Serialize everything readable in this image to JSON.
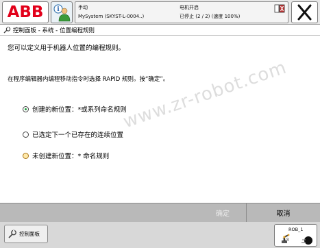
{
  "topbar": {
    "logo_text": "ABB",
    "status": {
      "mode": "手动",
      "system": "MySystem (SKYST-L-0004..)",
      "motor_state": "电机开启",
      "program_state": "已停止 (2 / 2) (速度 100%)"
    }
  },
  "breadcrumb": {
    "text": "控制面板 - 系统 - 位置编程规则"
  },
  "main": {
    "intro": "您可以定义用于机器人位置的编程规则。",
    "instruction": "在程序编辑器内编程移动指令时选择 RAPID 规则。按“确定”。",
    "options": [
      {
        "label": "创建的新位置：*或系列命名规则",
        "selected": true
      },
      {
        "label": "已选定下一个已存在的连续位置",
        "selected": false
      },
      {
        "label": "未创建新位置：* 命名规则",
        "selected": false
      }
    ],
    "watermark": "www.zr-robot.com"
  },
  "commandbar": {
    "ok_label": "确定",
    "cancel_label": "取消"
  },
  "taskbar": {
    "control_panel_label": "控制面板",
    "robot_label": "ROB_1",
    "robot_number": "1/3"
  },
  "colors": {
    "abb_red": "#e2001a",
    "selected_radio": "#1a9c3a",
    "command_bar": "#b9b9b9"
  }
}
